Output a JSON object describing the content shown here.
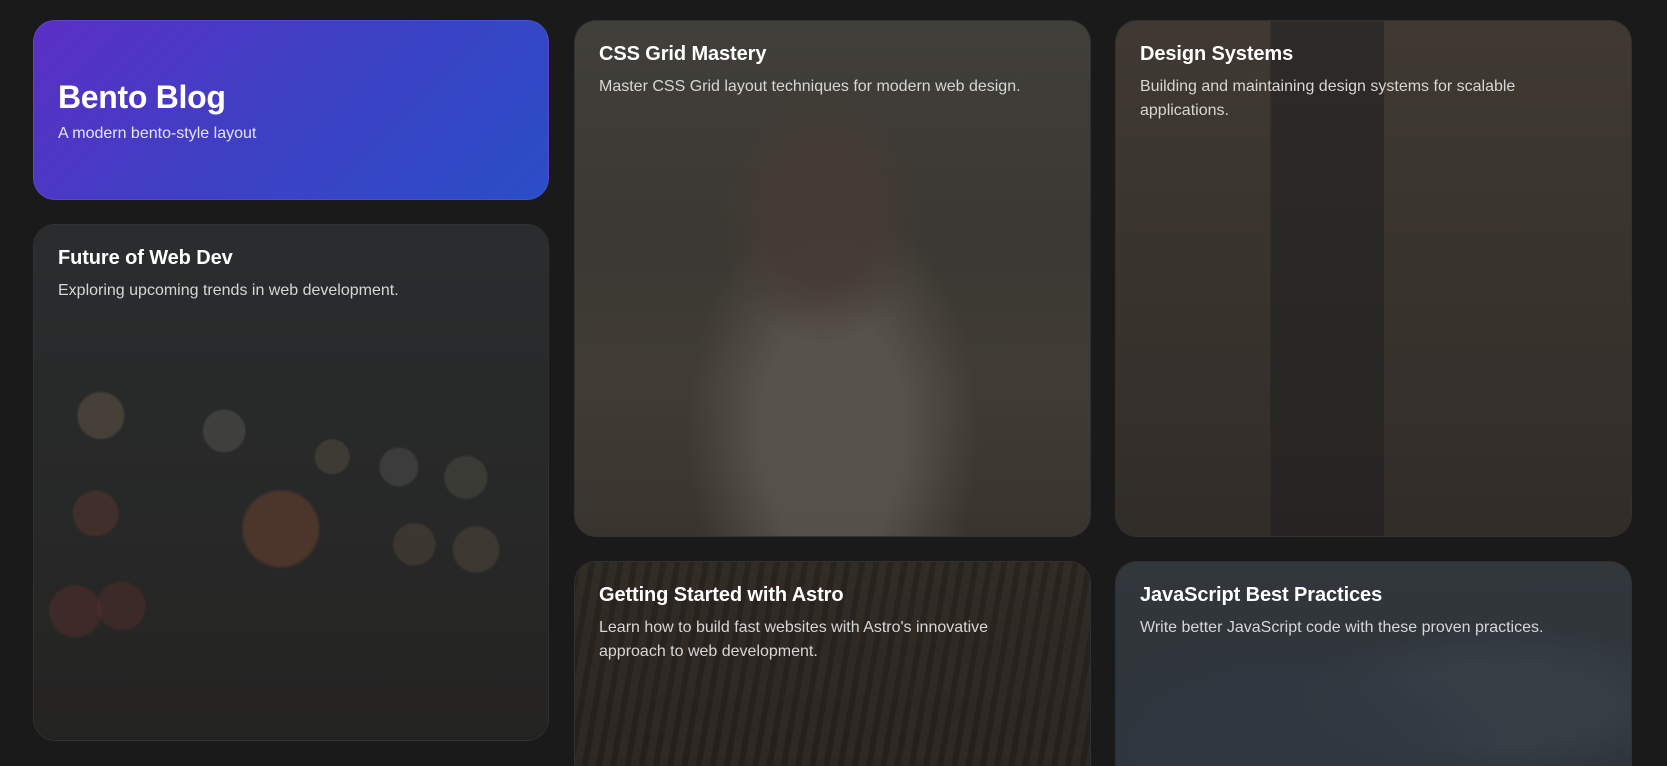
{
  "colors": {
    "page_background": "#1a1a1a",
    "hero_gradient_start": "#5b2fc5",
    "hero_gradient_end": "#2a4ec7",
    "title_text": "#ffffff",
    "body_text": "#d6d6d6"
  },
  "hero": {
    "title": "Bento Blog",
    "subtitle": "A modern bento-style layout"
  },
  "posts": [
    {
      "title": "Future of Web Dev",
      "excerpt": "Exploring upcoming trends in web development."
    },
    {
      "title": "CSS Grid Mastery",
      "excerpt": "Master CSS Grid layout techniques for modern web design."
    },
    {
      "title": "Design Systems",
      "excerpt": "Building and maintaining design systems for scalable applications."
    },
    {
      "title": "Getting Started with Astro",
      "excerpt": "Learn how to build fast websites with Astro's innovative approach to web development."
    },
    {
      "title": "JavaScript Best Practices",
      "excerpt": "Write better JavaScript code with these proven practices."
    }
  ]
}
